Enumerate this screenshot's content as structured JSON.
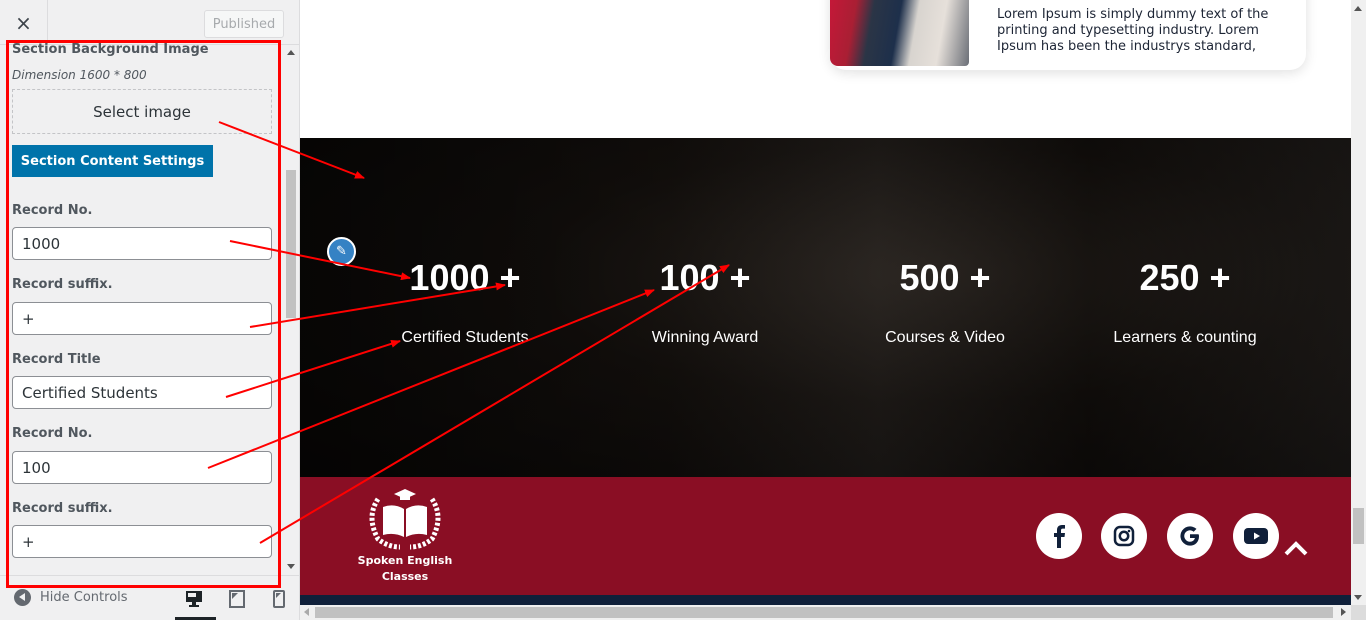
{
  "customizer": {
    "close_label": "×",
    "published_label": "Published",
    "section_title": "Section Background Image",
    "dimension_note": "Dimension 1600 * 800",
    "select_image_label": "Select image",
    "content_settings_label": "Section Content Settings",
    "fields": [
      {
        "label": "Record No.",
        "value": "1000"
      },
      {
        "label": "Record suffix.",
        "value": "+"
      },
      {
        "label": "Record Title",
        "value": "Certified Students"
      },
      {
        "label": "Record No.",
        "value": "100"
      },
      {
        "label": "Record suffix.",
        "value": "+"
      }
    ],
    "footer": {
      "hide_controls_label": "Hide Controls",
      "devices": [
        "desktop",
        "tablet",
        "mobile"
      ],
      "active_device": "desktop"
    }
  },
  "preview": {
    "card_text": "Lorem Ipsum is simply dummy text of the printing and typesetting industry. Lorem Ipsum has been the industrys standard,",
    "stats": [
      {
        "number": "1000",
        "suffix": "+",
        "title": "Certified Students"
      },
      {
        "number": "100",
        "suffix": "+",
        "title": "Winning Award"
      },
      {
        "number": "500",
        "suffix": "+",
        "title": "Courses & Video"
      },
      {
        "number": "250",
        "suffix": "+",
        "title": "Learners & counting"
      }
    ],
    "logo_text_line1": "Spoken English",
    "logo_text_line2": "Classes",
    "social": [
      "facebook",
      "instagram",
      "google",
      "youtube"
    ],
    "colors": {
      "footer_bg": "#8a0e24",
      "footer_bottom": "#10203a",
      "button_blue": "#0073aa",
      "annotation_red": "#ff0000",
      "social_icon": "#10203a"
    }
  }
}
